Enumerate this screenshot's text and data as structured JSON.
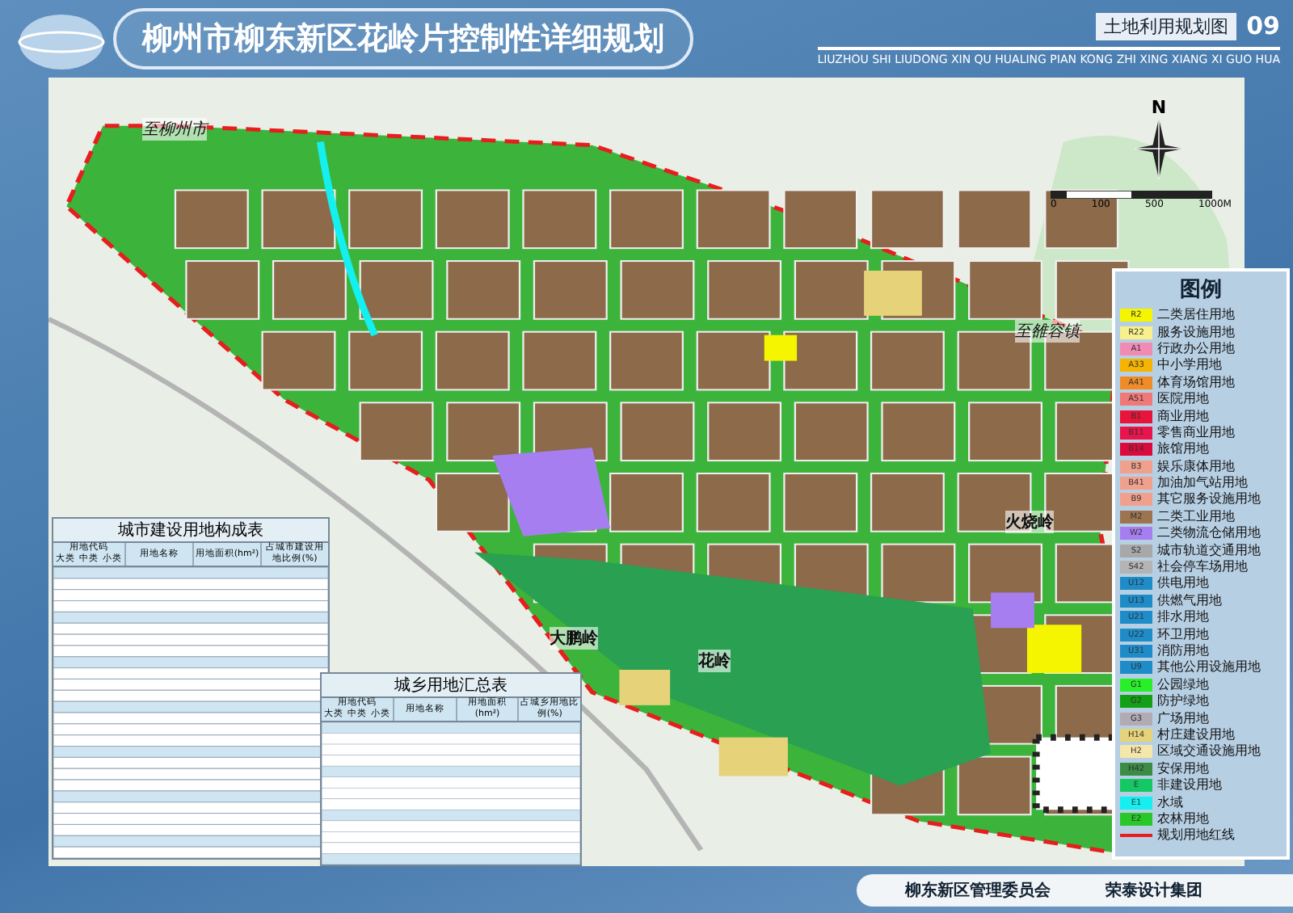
{
  "header": {
    "title": "柳州市柳东新区花岭片控制性详细规划",
    "subtitle": "LIUZHOU SHI LIUDONG XIN QU HUALING PIAN KONG ZHI XING XIANG XI GUO HUA",
    "sheet_name": "土地利用规划图",
    "sheet_number": "09"
  },
  "map": {
    "place_labels": [
      {
        "text": "至柳州市",
        "kind": "road"
      },
      {
        "text": "至雒容镇",
        "kind": "road"
      },
      {
        "text": "火烧岭",
        "kind": "hill"
      },
      {
        "text": "大鹏岭",
        "kind": "hill"
      },
      {
        "text": "花岭",
        "kind": "hill"
      }
    ],
    "compass": {
      "letter": "N"
    },
    "scale": {
      "ticks": [
        "0",
        "100",
        "500",
        "1000M"
      ]
    }
  },
  "legend": {
    "title": "图例",
    "items": [
      {
        "code": "R2",
        "name": "二类居住用地",
        "color": "#f5f500",
        "kind": "swatch"
      },
      {
        "code": "R22",
        "name": "服务设施用地",
        "color": "#f7f08c",
        "kind": "swatch"
      },
      {
        "code": "A1",
        "name": "行政办公用地",
        "color": "#f08cb4",
        "kind": "swatch"
      },
      {
        "code": "A33",
        "name": "中小学用地",
        "color": "#f5b400",
        "kind": "swatch"
      },
      {
        "code": "A41",
        "name": "体育场馆用地",
        "color": "#f08c28",
        "kind": "swatch"
      },
      {
        "code": "A51",
        "name": "医院用地",
        "color": "#f07878",
        "kind": "swatch"
      },
      {
        "code": "B1",
        "name": "商业用地",
        "color": "#e8143c",
        "kind": "swatch"
      },
      {
        "code": "B11",
        "name": "零售商业用地",
        "color": "#e8144b",
        "kind": "swatch"
      },
      {
        "code": "B14",
        "name": "旅馆用地",
        "color": "#dc0a3c",
        "kind": "swatch"
      },
      {
        "code": "B3",
        "name": "娱乐康体用地",
        "color": "#f0a08c",
        "kind": "swatch"
      },
      {
        "code": "B41",
        "name": "加油加气站用地",
        "color": "#f0a08c",
        "kind": "swatch"
      },
      {
        "code": "B9",
        "name": "其它服务设施用地",
        "color": "#f0a08c",
        "kind": "swatch"
      },
      {
        "code": "M2",
        "name": "二类工业用地",
        "color": "#9c7550",
        "kind": "swatch"
      },
      {
        "code": "W2",
        "name": "二类物流仓储用地",
        "color": "#a77ef0",
        "kind": "swatch"
      },
      {
        "code": "S2",
        "name": "城市轨道交通用地",
        "color": "#a8a8a8",
        "kind": "swatch"
      },
      {
        "code": "S42",
        "name": "社会停车场用地",
        "color": "#b4b4b4",
        "kind": "swatch"
      },
      {
        "code": "U12",
        "name": "供电用地",
        "color": "#1e8cc8",
        "kind": "swatch"
      },
      {
        "code": "U13",
        "name": "供燃气用地",
        "color": "#1e8cc8",
        "kind": "swatch"
      },
      {
        "code": "U21",
        "name": "排水用地",
        "color": "#1e8cc8",
        "kind": "swatch"
      },
      {
        "code": "U22",
        "name": "环卫用地",
        "color": "#1e8cc8",
        "kind": "swatch"
      },
      {
        "code": "U31",
        "name": "消防用地",
        "color": "#1e8cc8",
        "kind": "swatch"
      },
      {
        "code": "U9",
        "name": "其他公用设施用地",
        "color": "#1e8cc8",
        "kind": "swatch"
      },
      {
        "code": "G1",
        "name": "公园绿地",
        "color": "#28f028",
        "kind": "swatch"
      },
      {
        "code": "G2",
        "name": "防护绿地",
        "color": "#14a014",
        "kind": "swatch"
      },
      {
        "code": "G3",
        "name": "广场用地",
        "color": "#b4aab4",
        "kind": "swatch"
      },
      {
        "code": "H14",
        "name": "村庄建设用地",
        "color": "#e6d278",
        "kind": "swatch"
      },
      {
        "code": "H2",
        "name": "区域交通设施用地",
        "color": "#f5e6aa",
        "kind": "swatch"
      },
      {
        "code": "H42",
        "name": "安保用地",
        "color": "#3c8c46",
        "kind": "swatch"
      },
      {
        "code": "E",
        "name": "非建设用地",
        "color": "#14c864",
        "kind": "swatch"
      },
      {
        "code": "E1",
        "name": "水域",
        "color": "#14f0f0",
        "kind": "swatch"
      },
      {
        "code": "E2",
        "name": "农林用地",
        "color": "#28c828",
        "kind": "swatch"
      },
      {
        "name": "规划用地红线",
        "color": "#e61e1e",
        "kind": "line"
      }
    ]
  },
  "tables": [
    {
      "title": "城市建设用地构成表",
      "code_group": "用地代码",
      "code_columns": [
        "大类",
        "中类",
        "小类"
      ],
      "columns": [
        "用地名称",
        "用地面积(hm²)",
        "占城市建设用地比例(%)"
      ]
    },
    {
      "title": "城乡用地汇总表",
      "code_group": "用地代码",
      "code_columns": [
        "大类",
        "中类",
        "小类"
      ],
      "columns": [
        "用地名称",
        "用地面积(hm²)",
        "占城乡用地比例(%)"
      ]
    }
  ],
  "footer": {
    "items": [
      "柳东新区管理委员会",
      "荣泰设计集团"
    ]
  }
}
